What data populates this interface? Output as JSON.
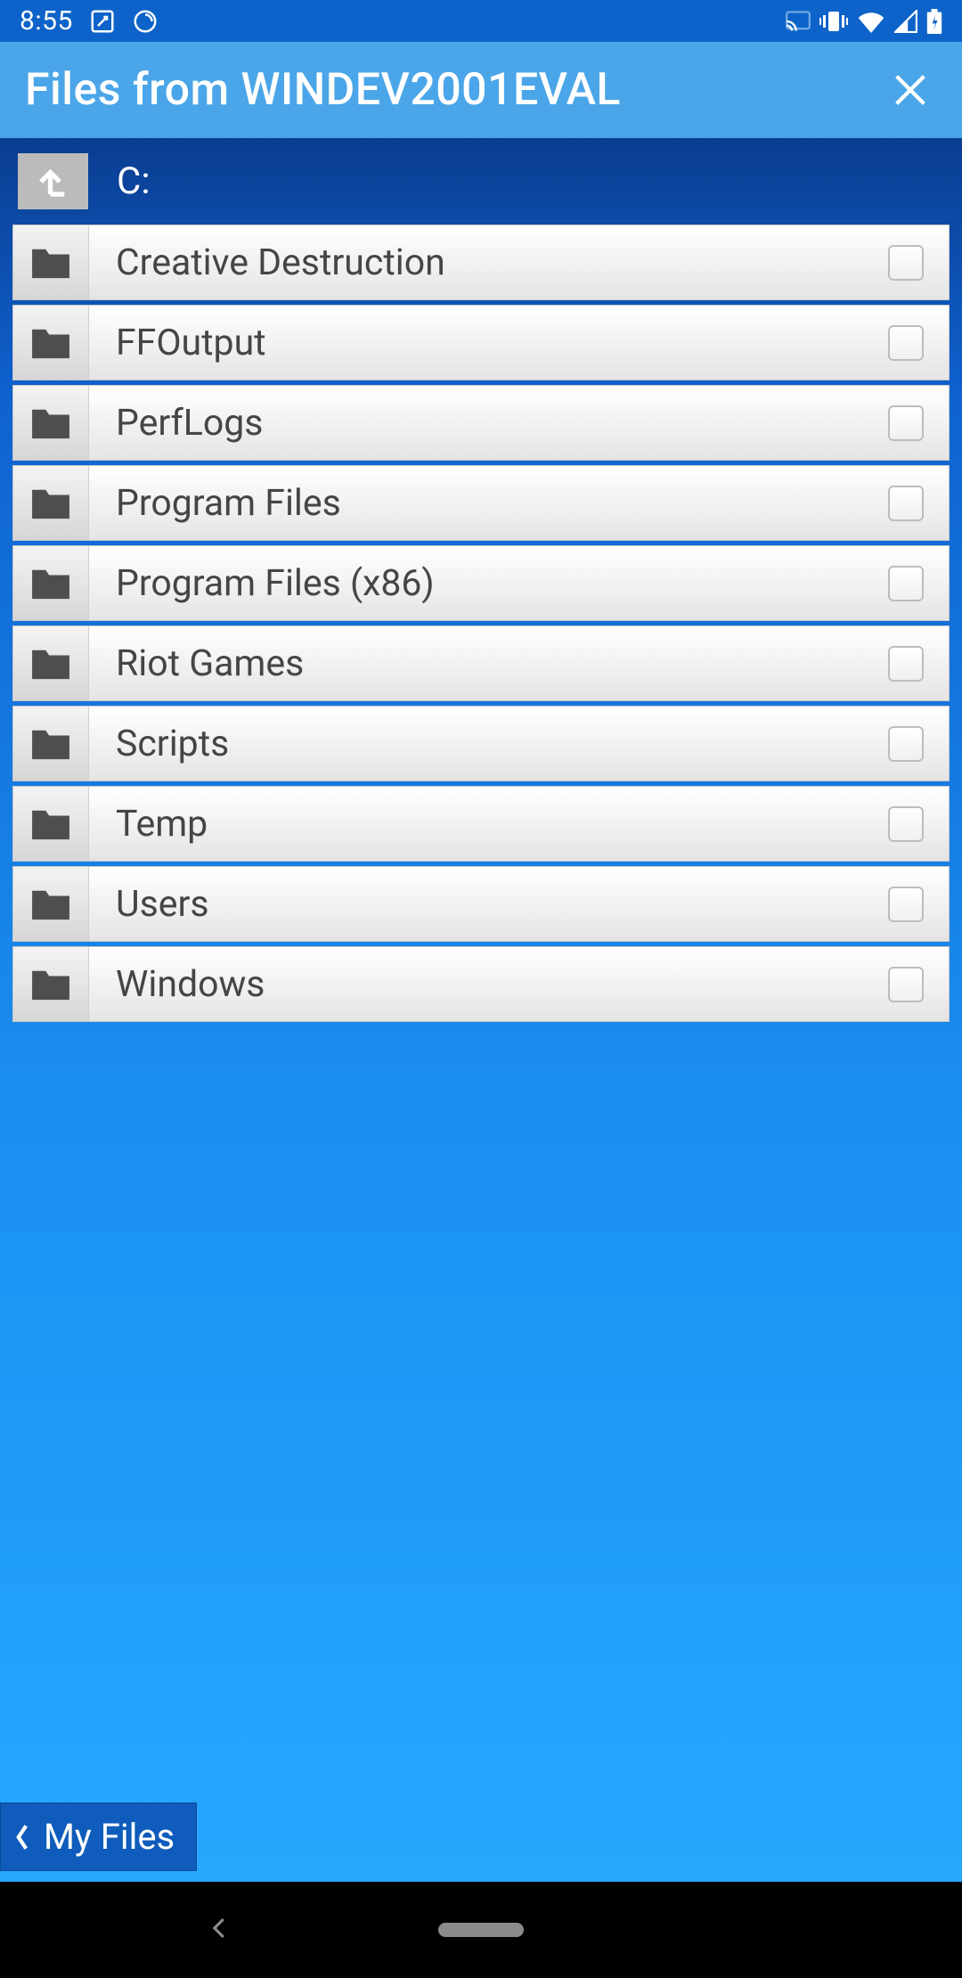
{
  "statusBar": {
    "time": "8:55"
  },
  "header": {
    "title": "Files from WINDEV2001EVAL"
  },
  "path": {
    "current": "C:"
  },
  "files": [
    {
      "name": "Creative Destruction",
      "checked": false
    },
    {
      "name": "FFOutput",
      "checked": false
    },
    {
      "name": "PerfLogs",
      "checked": false
    },
    {
      "name": "Program Files",
      "checked": false
    },
    {
      "name": "Program Files (x86)",
      "checked": false
    },
    {
      "name": "Riot Games",
      "checked": false
    },
    {
      "name": "Scripts",
      "checked": false
    },
    {
      "name": "Temp",
      "checked": false
    },
    {
      "name": "Users",
      "checked": false
    },
    {
      "name": "Windows",
      "checked": false
    }
  ],
  "bottomNav": {
    "label": "My Files"
  }
}
